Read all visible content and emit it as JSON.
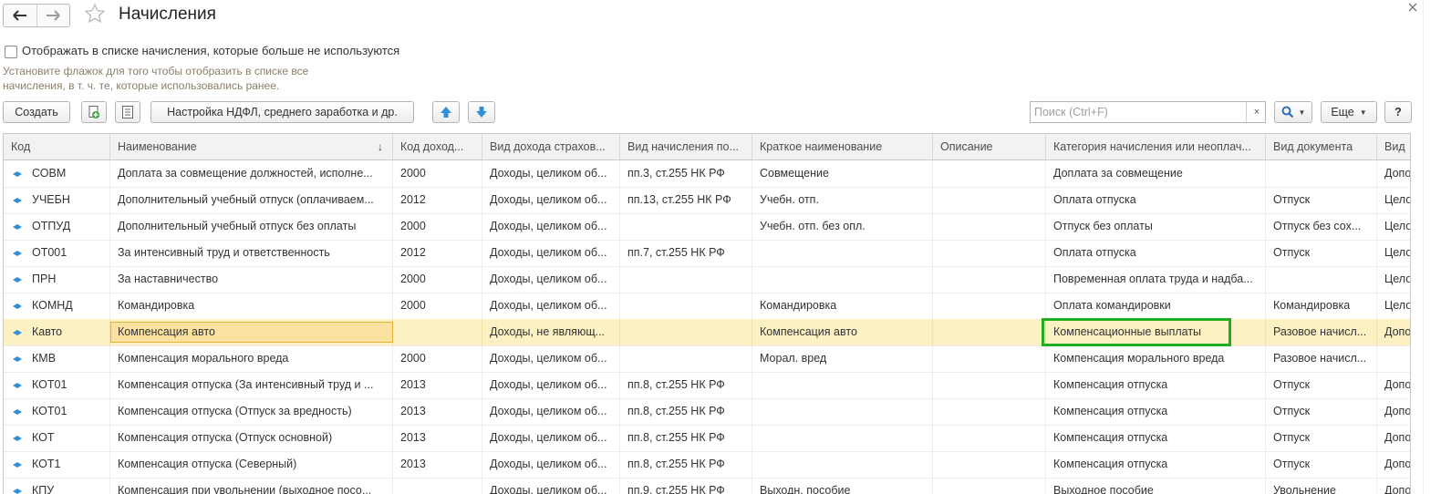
{
  "window": {
    "title": "Начисления"
  },
  "filter": {
    "checkbox_label": "Отображать в списке начисления, которые больше не используются",
    "checked": false,
    "hint_line1": "Установите флажок для того чтобы отобразить в списке все",
    "hint_line2": "начисления, в т. ч. те, которые использовались ранее."
  },
  "toolbar": {
    "create_label": "Создать",
    "ndfl_settings_label": "Настройка НДФЛ, среднего заработка и др.",
    "search_placeholder": "Поиск (Ctrl+F)",
    "search_clear": "×",
    "more_label": "Еще",
    "help_label": "?"
  },
  "table": {
    "columns": [
      "Код",
      "Наименование",
      "Код доход...",
      "Вид дохода страхов...",
      "Вид начисления по...",
      "Краткое наименование",
      "Описание",
      "Категория начисления или неоплач...",
      "Вид документа",
      "Вид"
    ],
    "sort_indicator": "↓",
    "rows": [
      [
        "СОВМ",
        "Доплата за совмещение должностей, исполне...",
        "2000",
        "Доходы, целиком об...",
        "пп.3, ст.255 НК РФ",
        "Совмещение",
        "",
        "Доплата за совмещение",
        "",
        "Допо"
      ],
      [
        "УЧЕБН",
        "Дополнительный учебный отпуск (оплачиваем...",
        "2012",
        "Доходы, целиком об...",
        "пп.13, ст.255 НК РФ",
        "Учебн. отп.",
        "",
        "Оплата отпуска",
        "Отпуск",
        "Цело"
      ],
      [
        "ОТПУД",
        "Дополнительный учебный отпуск без оплаты",
        "2000",
        "Доходы, целиком об...",
        "",
        "Учебн. отп. без опл.",
        "",
        "Отпуск без оплаты",
        "Отпуск без сох...",
        "Цело"
      ],
      [
        "ОТ001",
        "За интенсивный труд и ответственность",
        "2012",
        "Доходы, целиком об...",
        "пп.7, ст.255 НК РФ",
        "",
        "",
        "Оплата отпуска",
        "Отпуск",
        "Цело"
      ],
      [
        "ПРН",
        "За наставничество",
        "2000",
        "Доходы, целиком об...",
        "",
        "",
        "",
        "Повременная оплата труда и надба...",
        "",
        "Цело"
      ],
      [
        "КОМНД",
        "Командировка",
        "2000",
        "Доходы, целиком об...",
        "",
        "Командировка",
        "",
        "Оплата командировки",
        "Командировка",
        "Цело"
      ],
      [
        "Кавто",
        "Компенсация авто",
        "",
        "Доходы, не являющ...",
        "",
        "Компенсация авто",
        "",
        "Компенсационные выплаты",
        "Разовое начисл...",
        "Допо"
      ],
      [
        "КМВ",
        "Компенсация морального вреда",
        "2000",
        "Доходы, целиком об...",
        "",
        "Морал. вред",
        "",
        "Компенсация морального вреда",
        "Разовое начисл...",
        ""
      ],
      [
        "КОТ01",
        "Компенсация отпуска (За интенсивный труд и ...",
        "2013",
        "Доходы, целиком об...",
        "пп.8, ст.255 НК РФ",
        "",
        "",
        "Компенсация отпуска",
        "Отпуск",
        "Допо"
      ],
      [
        "КОТ01",
        "Компенсация отпуска (Отпуск за вредность)",
        "2013",
        "Доходы, целиком об...",
        "пп.8, ст.255 НК РФ",
        "",
        "",
        "Компенсация отпуска",
        "Отпуск",
        "Допо"
      ],
      [
        "КОТ",
        "Компенсация отпуска (Отпуск основной)",
        "2013",
        "Доходы, целиком об...",
        "пп.8, ст.255 НК РФ",
        "",
        "",
        "Компенсация отпуска",
        "Отпуск",
        "Допо"
      ],
      [
        "КОТ1",
        "Компенсация отпуска (Северный)",
        "2013",
        "Доходы, целиком об...",
        "пп.8, ст.255 НК РФ",
        "",
        "",
        "Компенсация отпуска",
        "Отпуск",
        "Допо"
      ],
      [
        "КПУ",
        "Компенсация при увольнении (выходное посо...",
        "",
        "Доходы, целиком об...",
        "пп.9, ст.255 НК РФ",
        "Выходн. пособие",
        "",
        "Выходное пособие",
        "Увольнение",
        "Допо"
      ]
    ],
    "selected_row": 6
  },
  "colors": {
    "selected_row_bg": "#fbf1c3",
    "focus_cell_bg": "#fbe2a0",
    "highlight_border": "#1fae1f",
    "hint_text": "#8a7f6a",
    "arrow_blue": "#2f8fd8"
  },
  "icons": {
    "back": "arrow-left-icon",
    "forward": "arrow-right-icon",
    "favorite": "star-icon",
    "close": "close-icon",
    "copy": "copy-add-icon",
    "list": "list-icon",
    "move_up": "arrow-up-icon",
    "move_down": "arrow-down-icon",
    "search": "search-icon",
    "row": "accrual-item-icon"
  }
}
